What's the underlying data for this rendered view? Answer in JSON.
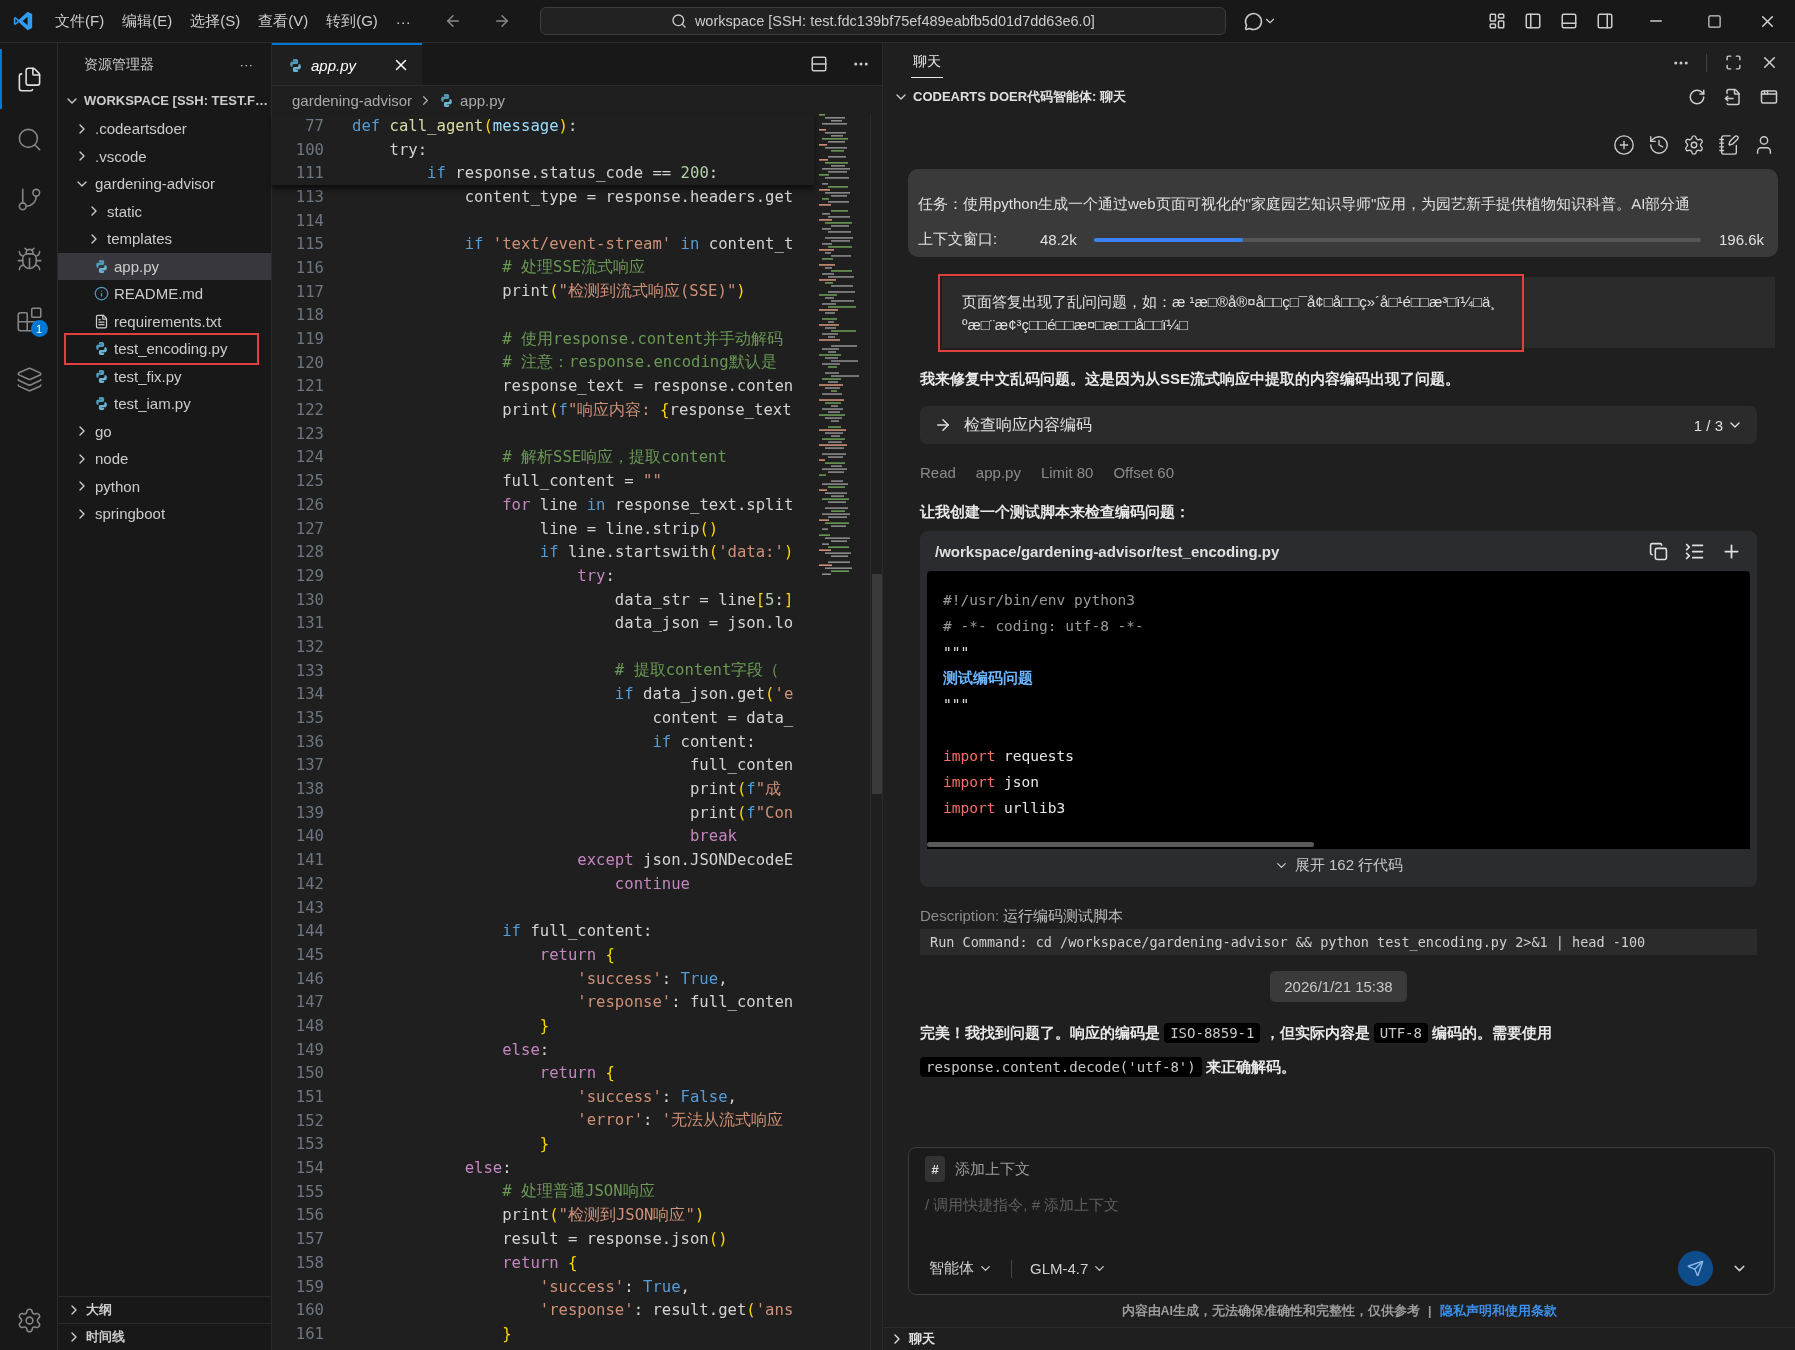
{
  "title_bar": {
    "menus": [
      "文件(F)",
      "编辑(E)",
      "选择(S)",
      "查看(V)",
      "转到(G)",
      "···"
    ],
    "search": "workspace [SSH: test.fdc139bf75ef489eabfb5d01d7dd63e6.0]"
  },
  "activity_bar": {
    "items": [
      {
        "kind": "files",
        "selected": true
      },
      {
        "kind": "search",
        "selected": false
      },
      {
        "kind": "source-control",
        "selected": false
      },
      {
        "kind": "run-debug",
        "selected": false
      },
      {
        "kind": "extensions",
        "selected": false,
        "badge": "1"
      },
      {
        "kind": "cloud",
        "selected": false
      }
    ],
    "bottom": [
      {
        "kind": "settings",
        "selected": false
      }
    ]
  },
  "explorer": {
    "title": "资源管理器",
    "menu": "···",
    "workspace": {
      "label": "WORKSPACE [SSH: TEST.F…",
      "expanded": true
    },
    "tree": [
      {
        "label": ".codeartsdoer",
        "kind": "folder",
        "expanded": false,
        "selected": false,
        "highlighted": false
      },
      {
        "label": ".vscode",
        "kind": "folder",
        "expanded": false,
        "selected": false,
        "highlighted": false
      },
      {
        "label": "gardening-advisor",
        "kind": "folder",
        "expanded": true,
        "selected": false,
        "highlighted": false,
        "children": [
          {
            "label": "static",
            "kind": "folder",
            "expanded": false,
            "selected": false,
            "highlighted": false
          },
          {
            "label": "templates",
            "kind": "folder",
            "expanded": false,
            "selected": false,
            "highlighted": false
          },
          {
            "label": "app.py",
            "kind": "python",
            "selected": true,
            "highlighted": false
          },
          {
            "label": "README.md",
            "kind": "info",
            "selected": false,
            "highlighted": false
          },
          {
            "label": "requirements.txt",
            "kind": "text",
            "selected": false,
            "highlighted": false
          },
          {
            "label": "test_encoding.py",
            "kind": "python",
            "selected": false,
            "highlighted": true
          },
          {
            "label": "test_fix.py",
            "kind": "python",
            "selected": false,
            "highlighted": false
          },
          {
            "label": "test_iam.py",
            "kind": "python",
            "selected": false,
            "highlighted": false
          }
        ]
      },
      {
        "label": "go",
        "kind": "folder",
        "expanded": false,
        "selected": false,
        "highlighted": false
      },
      {
        "label": "node",
        "kind": "folder",
        "expanded": false,
        "selected": false,
        "highlighted": false
      },
      {
        "label": "python",
        "kind": "folder",
        "expanded": false,
        "selected": false,
        "highlighted": false
      },
      {
        "label": "springboot",
        "kind": "folder",
        "expanded": false,
        "selected": false,
        "highlighted": false
      }
    ],
    "sections": [
      {
        "label": "大纲",
        "expanded": false
      },
      {
        "label": "时间线",
        "expanded": false
      }
    ]
  },
  "editor": {
    "tab": {
      "label": "app.py",
      "selected": true,
      "preview": true
    },
    "breadcrumbs": [
      "gardening-advisor",
      "app.py"
    ],
    "sticky_lines": [
      {
        "number": "77",
        "tokens": [
          {
            "text": "def ",
            "kind": "keyword"
          },
          {
            "text": "call_agent",
            "kind": "function"
          },
          {
            "text": "(",
            "kind": "bracket"
          },
          {
            "text": "message",
            "kind": "param"
          },
          {
            "text": ")",
            "kind": "bracket"
          },
          {
            "text": ":",
            "kind": "plain"
          }
        ]
      },
      {
        "number": "100",
        "tokens": [
          {
            "text": "    try:",
            "kind": "plain"
          }
        ]
      },
      {
        "number": "111",
        "tokens": [
          {
            "text": "        if ",
            "kind": "keyword"
          },
          {
            "text": "response.status_code == ",
            "kind": "plain"
          },
          {
            "text": "200",
            "kind": "number"
          },
          {
            "text": ":",
            "kind": "plain"
          }
        ]
      }
    ],
    "lines": [
      {
        "number": "113",
        "tokens": [
          {
            "text": "            content_type = response.headers.get",
            "kind": "plain"
          }
        ]
      },
      {
        "number": "114"
      },
      {
        "number": "115",
        "tokens": [
          {
            "text": "            if ",
            "kind": "keyword"
          },
          {
            "text": "'text/event-stream'",
            "kind": "string"
          },
          {
            "text": " in ",
            "kind": "keyword"
          },
          {
            "text": "content_t",
            "kind": "plain"
          }
        ]
      },
      {
        "number": "116",
        "tokens": [
          {
            "text": "                # 处理SSE流式响应",
            "kind": "comment"
          }
        ]
      },
      {
        "number": "117",
        "tokens": [
          {
            "text": "                print",
            "kind": "plain"
          },
          {
            "text": "(",
            "kind": "bracket"
          },
          {
            "text": "\"检测到流式响应(SSE)\"",
            "kind": "string"
          },
          {
            "text": ")",
            "kind": "bracket"
          }
        ]
      },
      {
        "number": "118"
      },
      {
        "number": "119",
        "tokens": [
          {
            "text": "                # 使用response.content并手动解码",
            "kind": "comment"
          }
        ]
      },
      {
        "number": "120",
        "tokens": [
          {
            "text": "                # 注意：response.encoding默认是",
            "kind": "comment"
          }
        ]
      },
      {
        "number": "121",
        "tokens": [
          {
            "text": "                response_text = response.conten",
            "kind": "plain"
          }
        ]
      },
      {
        "number": "122",
        "tokens": [
          {
            "text": "                print",
            "kind": "plain"
          },
          {
            "text": "(",
            "kind": "bracket"
          },
          {
            "text": "f",
            "kind": "keyword"
          },
          {
            "text": "\"响应内容: ",
            "kind": "string"
          },
          {
            "text": "{",
            "kind": "bracket"
          },
          {
            "text": "response_text",
            "kind": "plain"
          }
        ]
      },
      {
        "number": "123"
      },
      {
        "number": "124",
        "tokens": [
          {
            "text": "                # 解析SSE响应，提取content",
            "kind": "comment"
          }
        ]
      },
      {
        "number": "125",
        "tokens": [
          {
            "text": "                full_content = ",
            "kind": "plain"
          },
          {
            "text": "\"\"",
            "kind": "string"
          }
        ]
      },
      {
        "number": "126",
        "tokens": [
          {
            "text": "                for ",
            "kind": "control"
          },
          {
            "text": "line ",
            "kind": "plain"
          },
          {
            "text": "in ",
            "kind": "keyword"
          },
          {
            "text": "response_text.split",
            "kind": "plain"
          }
        ]
      },
      {
        "number": "127",
        "tokens": [
          {
            "text": "                    line = line.strip",
            "kind": "plain"
          },
          {
            "text": "()",
            "kind": "bracket"
          }
        ]
      },
      {
        "number": "128",
        "tokens": [
          {
            "text": "                    if ",
            "kind": "keyword"
          },
          {
            "text": "line.startswith",
            "kind": "plain"
          },
          {
            "text": "(",
            "kind": "bracket"
          },
          {
            "text": "'data:'",
            "kind": "string"
          },
          {
            "text": ")",
            "kind": "bracket"
          }
        ]
      },
      {
        "number": "129",
        "tokens": [
          {
            "text": "                        try",
            "kind": "control"
          },
          {
            "text": ":",
            "kind": "plain"
          }
        ]
      },
      {
        "number": "130",
        "tokens": [
          {
            "text": "                            data_str = line",
            "kind": "plain"
          },
          {
            "text": "[",
            "kind": "bracket"
          },
          {
            "text": "5",
            "kind": "number"
          },
          {
            "text": ":",
            "kind": "plain"
          },
          {
            "text": "]",
            "kind": "bracket"
          }
        ]
      },
      {
        "number": "131",
        "tokens": [
          {
            "text": "                            data_json = json.lo",
            "kind": "plain"
          }
        ]
      },
      {
        "number": "132"
      },
      {
        "number": "133",
        "tokens": [
          {
            "text": "                            # 提取content字段（",
            "kind": "comment"
          }
        ]
      },
      {
        "number": "134",
        "tokens": [
          {
            "text": "                            if ",
            "kind": "keyword"
          },
          {
            "text": "data_json.get",
            "kind": "plain"
          },
          {
            "text": "(",
            "kind": "bracket"
          },
          {
            "text": "'e",
            "kind": "string"
          }
        ]
      },
      {
        "number": "135",
        "tokens": [
          {
            "text": "                                content = data_",
            "kind": "plain"
          }
        ]
      },
      {
        "number": "136",
        "tokens": [
          {
            "text": "                                if ",
            "kind": "keyword"
          },
          {
            "text": "content:",
            "kind": "plain"
          }
        ]
      },
      {
        "number": "137",
        "tokens": [
          {
            "text": "                                    full_conten",
            "kind": "plain"
          }
        ]
      },
      {
        "number": "138",
        "tokens": [
          {
            "text": "                                    print",
            "kind": "plain"
          },
          {
            "text": "(",
            "kind": "bracket"
          },
          {
            "text": "f",
            "kind": "keyword"
          },
          {
            "text": "\"成",
            "kind": "string"
          }
        ]
      },
      {
        "number": "139",
        "tokens": [
          {
            "text": "                                    print",
            "kind": "plain"
          },
          {
            "text": "(",
            "kind": "bracket"
          },
          {
            "text": "f",
            "kind": "keyword"
          },
          {
            "text": "\"Con",
            "kind": "string"
          }
        ]
      },
      {
        "number": "140",
        "tokens": [
          {
            "text": "                                    break",
            "kind": "control"
          }
        ]
      },
      {
        "number": "141",
        "tokens": [
          {
            "text": "                        except ",
            "kind": "control"
          },
          {
            "text": "json.JSONDecodeE",
            "kind": "plain"
          }
        ]
      },
      {
        "number": "142",
        "tokens": [
          {
            "text": "                            continue",
            "kind": "control"
          }
        ]
      },
      {
        "number": "143"
      },
      {
        "number": "144",
        "tokens": [
          {
            "text": "                if ",
            "kind": "keyword"
          },
          {
            "text": "full_content:",
            "kind": "plain"
          }
        ]
      },
      {
        "number": "145",
        "tokens": [
          {
            "text": "                    return ",
            "kind": "control"
          },
          {
            "text": "{",
            "kind": "bracket"
          }
        ]
      },
      {
        "number": "146",
        "tokens": [
          {
            "text": "                        'success'",
            "kind": "string"
          },
          {
            "text": ": ",
            "kind": "plain"
          },
          {
            "text": "True",
            "kind": "constant"
          },
          {
            "text": ",",
            "kind": "plain"
          }
        ]
      },
      {
        "number": "147",
        "tokens": [
          {
            "text": "                        'response'",
            "kind": "string"
          },
          {
            "text": ": full_conten",
            "kind": "plain"
          }
        ]
      },
      {
        "number": "148",
        "tokens": [
          {
            "text": "                    }",
            "kind": "bracket"
          }
        ]
      },
      {
        "number": "149",
        "tokens": [
          {
            "text": "                else",
            "kind": "control"
          },
          {
            "text": ":",
            "kind": "plain"
          }
        ]
      },
      {
        "number": "150",
        "tokens": [
          {
            "text": "                    return ",
            "kind": "control"
          },
          {
            "text": "{",
            "kind": "bracket"
          }
        ]
      },
      {
        "number": "151",
        "tokens": [
          {
            "text": "                        'success'",
            "kind": "string"
          },
          {
            "text": ": ",
            "kind": "plain"
          },
          {
            "text": "False",
            "kind": "constant"
          },
          {
            "text": ",",
            "kind": "plain"
          }
        ]
      },
      {
        "number": "152",
        "tokens": [
          {
            "text": "                        'error'",
            "kind": "string"
          },
          {
            "text": ": ",
            "kind": "plain"
          },
          {
            "text": "'无法从流式响应",
            "kind": "string"
          }
        ]
      },
      {
        "number": "153",
        "tokens": [
          {
            "text": "                    }",
            "kind": "bracket"
          }
        ]
      },
      {
        "number": "154",
        "tokens": [
          {
            "text": "            else",
            "kind": "control"
          },
          {
            "text": ":",
            "kind": "plain"
          }
        ]
      },
      {
        "number": "155",
        "tokens": [
          {
            "text": "                # 处理普通JSON响应",
            "kind": "comment"
          }
        ]
      },
      {
        "number": "156",
        "tokens": [
          {
            "text": "                print",
            "kind": "plain"
          },
          {
            "text": "(",
            "kind": "bracket"
          },
          {
            "text": "\"检测到JSON响应\"",
            "kind": "string"
          },
          {
            "text": ")",
            "kind": "bracket"
          }
        ]
      },
      {
        "number": "157",
        "tokens": [
          {
            "text": "                result = response.json",
            "kind": "plain"
          },
          {
            "text": "()",
            "kind": "bracket"
          }
        ]
      },
      {
        "number": "158",
        "tokens": [
          {
            "text": "                return ",
            "kind": "control"
          },
          {
            "text": "{",
            "kind": "bracket"
          }
        ]
      },
      {
        "number": "159",
        "tokens": [
          {
            "text": "                    'success'",
            "kind": "string"
          },
          {
            "text": ": ",
            "kind": "plain"
          },
          {
            "text": "True",
            "kind": "constant"
          },
          {
            "text": ",",
            "kind": "plain"
          }
        ]
      },
      {
        "number": "160",
        "tokens": [
          {
            "text": "                    'response'",
            "kind": "string"
          },
          {
            "text": ": result.get",
            "kind": "plain"
          },
          {
            "text": "(",
            "kind": "bracket"
          },
          {
            "text": "'ans",
            "kind": "string"
          }
        ]
      },
      {
        "number": "161",
        "tokens": [
          {
            "text": "                }",
            "kind": "bracket"
          }
        ]
      }
    ]
  },
  "chat": {
    "tab": {
      "label": "聊天",
      "selected": true
    },
    "section_title": "CODEARTS DOER代码智能体: 聊天",
    "task": {
      "text": "任务：使用python生成一个通过web页面可视化的\"家庭园艺知识导师\"应用，为园艺新手提供植物知识科普。AI部分通"
    },
    "context": {
      "label": "上下文窗口:",
      "used": "48.2k",
      "level": 0.245,
      "total": "196.6k"
    },
    "user_message": {
      "text": "页面答复出现了乱问问题，如：æ ¹æ□®å®¤å□□ç□¯å¢□å□□ç»´å□¹é□□æ³□ï¼□ä¸ºæ□¨æ¢³ç□□é□□æ¤□æ□□å□□ï¼□",
      "highlighted": true
    },
    "items": [
      {
        "kind": "text",
        "text": "我来修复中文乱码问题。这是因为从SSE流式响应中提取的内容编码出现了问题。"
      },
      {
        "kind": "step",
        "title": "检查响应内容编码",
        "counter": "1 / 3"
      },
      {
        "kind": "tool",
        "parts": [
          "Read",
          "app.py",
          "Limit 80",
          "Offset 60"
        ]
      },
      {
        "kind": "text",
        "text": "让我创建一个测试脚本来检查编码问题："
      },
      {
        "kind": "code_block",
        "path": "/workspace/gardening-advisor/test_encoding.py",
        "expand": "展开 162 行代码",
        "lines": [
          {
            "kind": "code",
            "tokens": [
              {
                "text": "#!/usr/bin/env python3",
                "kind": "comment"
              }
            ]
          },
          {
            "kind": "code",
            "tokens": [
              {
                "text": "# -*- coding: utf-8 -*-",
                "kind": "comment"
              }
            ]
          },
          {
            "kind": "code",
            "tokens": [
              {
                "text": "\"\"\"",
                "kind": "doc"
              }
            ]
          },
          {
            "kind": "code",
            "tokens": [
              {
                "text": "测试编码问题",
                "kind": "doc-title"
              }
            ]
          },
          {
            "kind": "code",
            "tokens": [
              {
                "text": "\"\"\"",
                "kind": "doc"
              }
            ]
          },
          {
            "kind": "blank"
          },
          {
            "kind": "code",
            "tokens": [
              {
                "text": "import",
                "kind": "import"
              },
              {
                "text": " requests",
                "kind": "plain"
              }
            ]
          },
          {
            "kind": "code",
            "tokens": [
              {
                "text": "import",
                "kind": "import"
              },
              {
                "text": " json",
                "kind": "plain"
              }
            ]
          },
          {
            "kind": "code",
            "tokens": [
              {
                "text": "import",
                "kind": "import"
              },
              {
                "text": " urllib3",
                "kind": "plain"
              }
            ]
          }
        ]
      },
      {
        "kind": "description",
        "label": "Description:",
        "text": "运行编码测试脚本"
      },
      {
        "kind": "command",
        "text": "Run Command: cd /workspace/gardening-advisor && python test_encoding.py 2>&1 | head -100"
      },
      {
        "kind": "timestamp",
        "text": "2026/1/21 15:38"
      },
      {
        "kind": "rich",
        "parts": [
          {
            "text": "完美！我找到问题了。响应的编码是 ",
            "kind": "text"
          },
          {
            "text": "ISO-8859-1",
            "kind": "code"
          },
          {
            "text": " ，但实际内容是 ",
            "kind": "text"
          },
          {
            "text": "UTF-8",
            "kind": "code"
          },
          {
            "text": " 编码的。需要使用 ",
            "kind": "text"
          },
          {
            "text": "response.content.decode('utf-8')",
            "kind": "code"
          },
          {
            "text": " 来正确解码。",
            "kind": "text"
          }
        ]
      }
    ],
    "composer": {
      "chip": "#",
      "context_label": "添加上下文",
      "placeholder": "/ 调用快捷指令, # 添加上下文",
      "mode": "智能体",
      "model": "GLM-4.7"
    },
    "footer": {
      "notice": "内容由AI生成，无法确保准确性和完整性，仅供参考",
      "separator": "|",
      "link": "隐私声明和使用条款"
    },
    "bottom_section": {
      "label": "聊天",
      "expanded": false
    }
  }
}
